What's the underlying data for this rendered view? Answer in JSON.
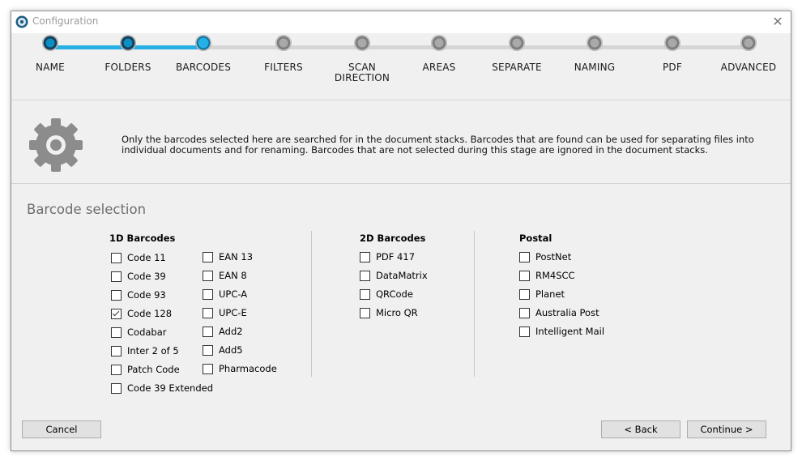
{
  "window": {
    "title": "Configuration",
    "close_glyph": "✕"
  },
  "wizard": {
    "steps": [
      {
        "label": "NAME",
        "state": "done"
      },
      {
        "label": "FOLDERS",
        "state": "done"
      },
      {
        "label": "BARCODES",
        "state": "current"
      },
      {
        "label": "FILTERS",
        "state": "pending"
      },
      {
        "label": "SCAN\nDIRECTION",
        "state": "pending"
      },
      {
        "label": "AREAS",
        "state": "pending"
      },
      {
        "label": "SEPARATE",
        "state": "pending"
      },
      {
        "label": "NAMING",
        "state": "pending"
      },
      {
        "label": "PDF",
        "state": "pending"
      },
      {
        "label": "ADVANCED",
        "state": "pending"
      }
    ],
    "active_color": "#27b0e3",
    "pending_color": "#d6d6d6"
  },
  "info": {
    "icon": "gear-icon",
    "text": "Only the barcodes selected here are searched for in the document stacks. Barcodes that are found can be used for separating files into individual documents and for renaming. Barcodes that are not selected during this stage are ignored in the document stacks."
  },
  "selection": {
    "title": "Barcode selection",
    "groups": {
      "one_d": {
        "title": "1D Barcodes",
        "col1": [
          {
            "label": "Code 11",
            "checked": false
          },
          {
            "label": "Code 39",
            "checked": false
          },
          {
            "label": "Code 93",
            "checked": false
          },
          {
            "label": "Code 128",
            "checked": true
          },
          {
            "label": "Codabar",
            "checked": false
          },
          {
            "label": "Inter 2 of 5",
            "checked": false
          },
          {
            "label": "Patch Code",
            "checked": false
          },
          {
            "label": "Code 39 Extended",
            "checked": false
          }
        ],
        "col2": [
          {
            "label": "EAN 13",
            "checked": false
          },
          {
            "label": "EAN 8",
            "checked": false
          },
          {
            "label": "UPC-A",
            "checked": false
          },
          {
            "label": "UPC-E",
            "checked": false
          },
          {
            "label": "Add2",
            "checked": false
          },
          {
            "label": "Add5",
            "checked": false
          },
          {
            "label": "Pharmacode",
            "checked": false
          }
        ]
      },
      "two_d": {
        "title": "2D Barcodes",
        "items": [
          {
            "label": "PDF 417",
            "checked": false
          },
          {
            "label": "DataMatrix",
            "checked": false
          },
          {
            "label": "QRCode",
            "checked": false
          },
          {
            "label": "Micro QR",
            "checked": false
          }
        ]
      },
      "postal": {
        "title": "Postal",
        "items": [
          {
            "label": "PostNet",
            "checked": false
          },
          {
            "label": "RM4SCC",
            "checked": false
          },
          {
            "label": "Planet",
            "checked": false
          },
          {
            "label": "Australia Post",
            "checked": false
          },
          {
            "label": "Intelligent Mail",
            "checked": false
          }
        ]
      }
    }
  },
  "buttons": {
    "cancel": "Cancel",
    "back": "< Back",
    "continue": "Continue >"
  }
}
